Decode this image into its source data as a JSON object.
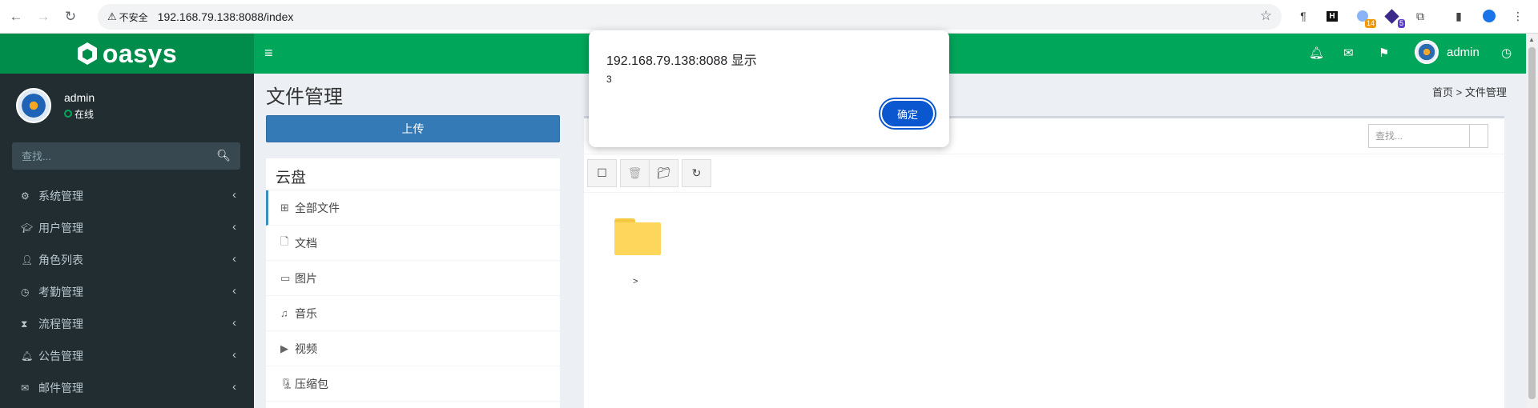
{
  "browser": {
    "back_icon": "←",
    "forward_icon": "→",
    "reload_icon": "↻",
    "security_label": "不安全",
    "url": "192.168.79.138:8088/index",
    "ext_badge_1": "14",
    "ext_badge_2": "5"
  },
  "header": {
    "logo_text": "oasys",
    "menu_icon": "≡",
    "username": "admin"
  },
  "sidebar": {
    "username": "admin",
    "status": "在线",
    "search_placeholder": "查找...",
    "items": [
      {
        "label": "系统管理",
        "icon": "gear-icon"
      },
      {
        "label": "用户管理",
        "icon": "graduation-cap-icon"
      },
      {
        "label": "角色列表",
        "icon": "user-icon"
      },
      {
        "label": "考勤管理",
        "icon": "clock-icon"
      },
      {
        "label": "流程管理",
        "icon": "hourglass-icon"
      },
      {
        "label": "公告管理",
        "icon": "bell-icon"
      },
      {
        "label": "邮件管理",
        "icon": "envelope-icon"
      }
    ]
  },
  "content": {
    "title": "文件管理",
    "breadcrumb": "首页 > 文件管理",
    "upload_label": "上传",
    "cloud_title": "云盘",
    "cloud_items": [
      {
        "label": "全部文件",
        "icon": "grid-icon"
      },
      {
        "label": "文档",
        "icon": "document-icon"
      },
      {
        "label": "图片",
        "icon": "image-icon"
      },
      {
        "label": "音乐",
        "icon": "music-icon"
      },
      {
        "label": "视频",
        "icon": "play-circle-icon"
      },
      {
        "label": "压缩包",
        "icon": "archive-icon"
      }
    ],
    "search_placeholder": "查找...",
    "folder_label": ">"
  },
  "dialog": {
    "title": "192.168.79.138:8088 显示",
    "message": "3",
    "ok_label": "确定"
  }
}
